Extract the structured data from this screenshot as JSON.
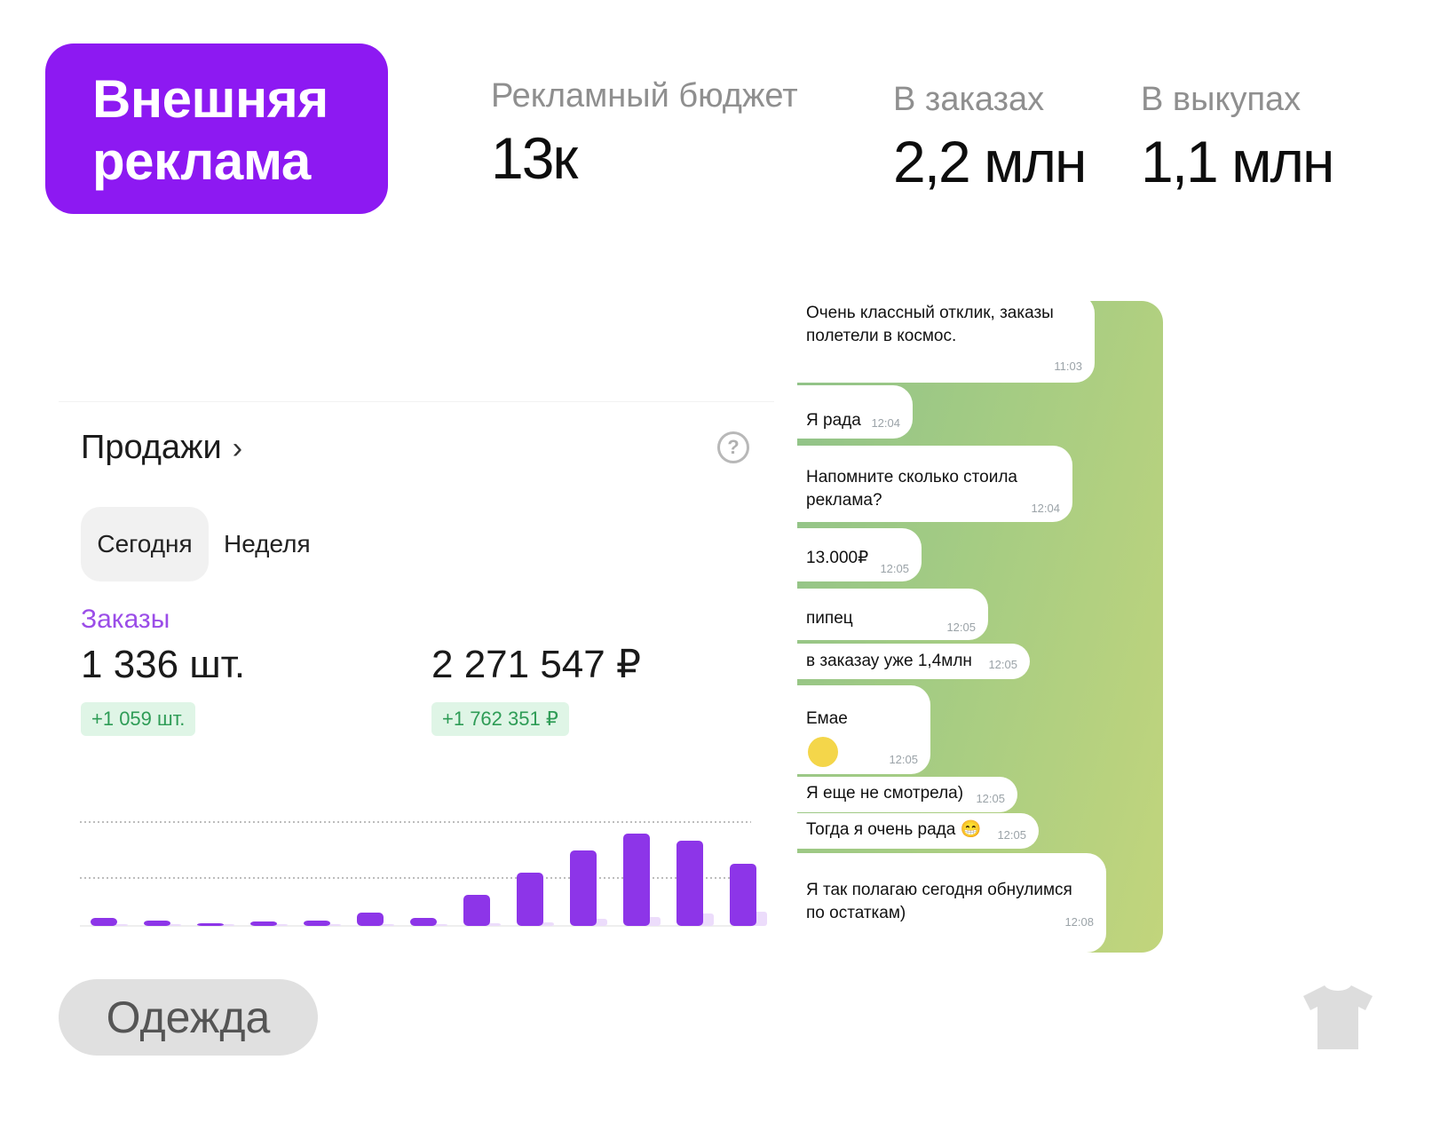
{
  "badge": {
    "line1": "Внешняя",
    "line2": "реклама"
  },
  "stats": [
    {
      "label": "Рекламный бюджет",
      "value": "13к"
    },
    {
      "label": "В заказах",
      "value": "2,2 млн"
    },
    {
      "label": "В выкупах",
      "value": "1,1 млн"
    }
  ],
  "sales": {
    "title": "Продажи",
    "chevron": "›",
    "help_icon": "question-circle-icon",
    "tabs": [
      "Сегодня",
      "Неделя"
    ],
    "orders_label": "Заказы",
    "count": "1 336 шт.",
    "count_delta": "+1 059 шт.",
    "sum": "2 271 547 ₽",
    "sum_delta": "+1 762 351 ₽"
  },
  "chart_data": {
    "type": "bar",
    "series": [
      {
        "values": [
          9,
          6,
          2,
          5,
          6,
          15,
          9,
          35,
          60,
          85,
          104,
          96,
          70
        ]
      },
      {
        "values": [
          1,
          1,
          1,
          1,
          1,
          2,
          1,
          3,
          4,
          8,
          10,
          14,
          16
        ]
      }
    ],
    "grid": true,
    "colors": {
      "primary": "#8d35e8",
      "secondary": "#ecdcfb"
    }
  },
  "chat": {
    "messages": [
      {
        "text": [
          "Очень классный отклик, заказы",
          "полетели в космос."
        ],
        "time": "11:03"
      },
      {
        "text": [
          "Я рада"
        ],
        "time": "12:04"
      },
      {
        "text": [
          "Напомните сколько стоила",
          "реклама?"
        ],
        "time": "12:04"
      },
      {
        "text": [
          "13.000₽"
        ],
        "time": "12:05"
      },
      {
        "text": [
          "пипец"
        ],
        "time": "12:05"
      },
      {
        "text": [
          "в заказау уже 1,4млн"
        ],
        "time": "12:05"
      },
      {
        "text": [
          "Емае"
        ],
        "time": "12:05"
      },
      {
        "text": [
          "Я еще не смотрела)"
        ],
        "time": "12:05"
      },
      {
        "text": [
          "Тогда я очень рада 😁"
        ],
        "time": "12:05"
      },
      {
        "text": [
          "Я так полагаю сегодня обнулимся",
          "по остаткам)"
        ],
        "time": "12:08"
      }
    ]
  },
  "category": {
    "label": "Одежда",
    "icon": "t-shirt-icon"
  }
}
